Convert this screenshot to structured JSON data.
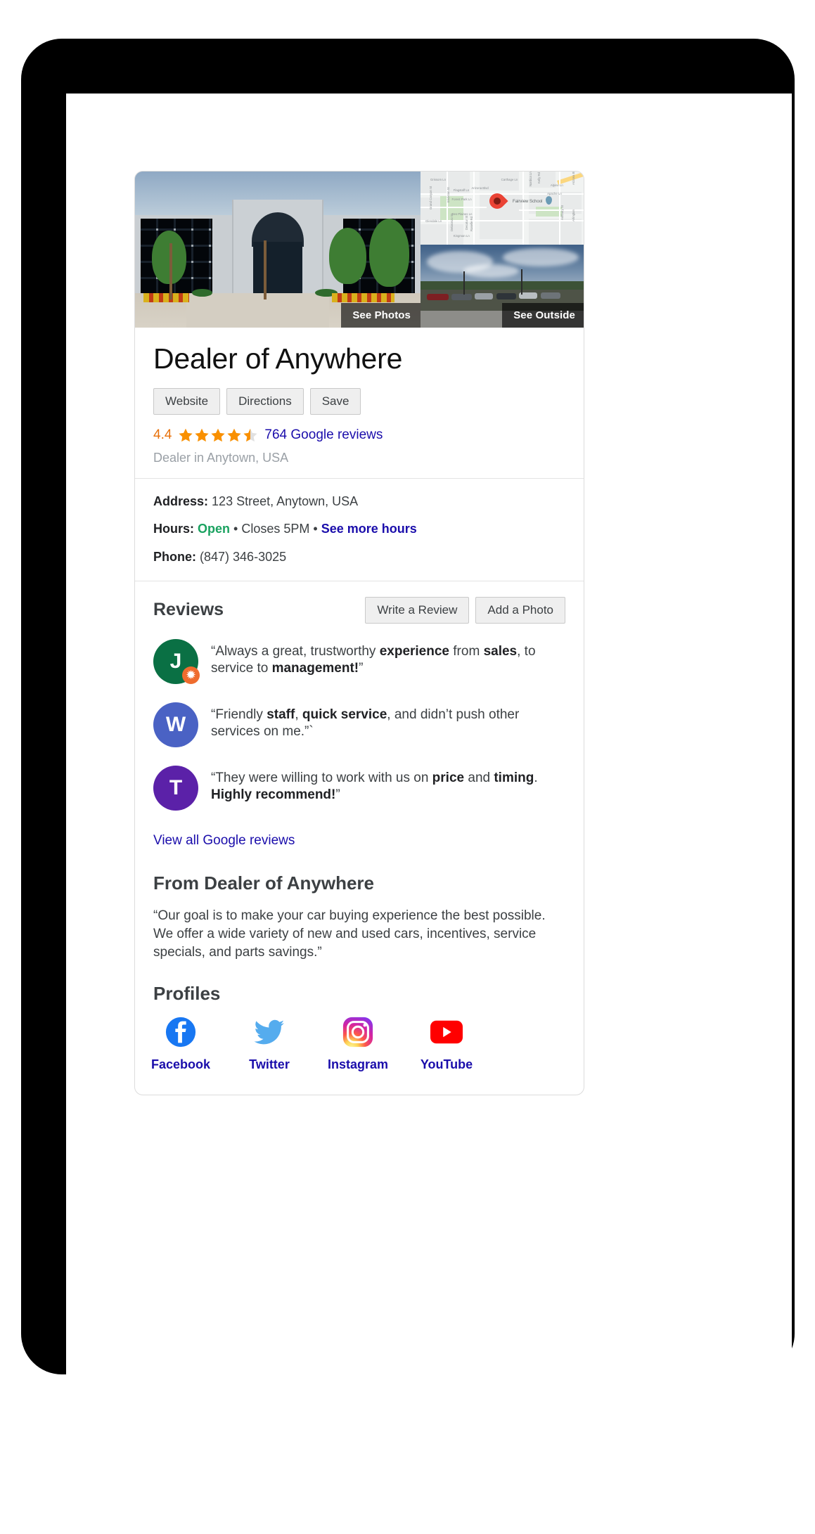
{
  "media": {
    "photos_caption": "See Photos",
    "outside_caption": "See Outside",
    "map": {
      "poi_label": "Fairview School",
      "street_labels": [
        "Grissom Ln",
        "Flagstaff Ln",
        "Forest Park Ln",
        "Des Plaines Ln",
        "Glendale Ln",
        "Kingman Ln",
        "Carthage Ln",
        "Arizona Blvd",
        "Alpine Ln",
        "Apache Ln",
        "Grand Canyon St",
        "Roselle Rd",
        "Decatur St",
        "Deloronzo St",
        "Erickson St",
        "Kelly Rd",
        "Nordica Ln",
        "Arizona Blvd",
        "Ashbury St",
        "Arlington St"
      ]
    }
  },
  "business": {
    "name": "Dealer of Anywhere",
    "category_location": "Dealer in Anytown, USA",
    "actions": [
      {
        "label": "Website"
      },
      {
        "label": "Directions"
      },
      {
        "label": "Save"
      }
    ],
    "rating": {
      "value": "4.4",
      "value_number": 4.4,
      "stars_filled": 4,
      "stars_half": 1,
      "stars_total": 5,
      "reviews_link": "764 Google reviews",
      "review_count": 764
    }
  },
  "facts": {
    "address_label": "Address:",
    "address_value": "123 Street, Anytown, USA",
    "hours_label": "Hours:",
    "hours_status": "Open",
    "hours_sep1": "•",
    "hours_closes": "Closes 5PM",
    "hours_sep2": "•",
    "hours_link": "See more hours",
    "phone_label": "Phone:",
    "phone_value": "(847) 346-3025"
  },
  "reviews": {
    "heading": "Reviews",
    "write_button": "Write a Review",
    "photo_button": "Add a Photo",
    "view_all_link": "View all Google reviews",
    "items": [
      {
        "initial": "J",
        "avatar_color": "#0a7044",
        "badge": true,
        "badge_icon": "star-badge-icon",
        "parts": [
          {
            "t": "“Always a great, trustworthy ",
            "b": false
          },
          {
            "t": "experience",
            "b": true
          },
          {
            "t": " from ",
            "b": false
          },
          {
            "t": "sales",
            "b": true
          },
          {
            "t": ", to service to ",
            "b": false
          },
          {
            "t": "management!",
            "b": true
          },
          {
            "t": "”",
            "b": false
          }
        ]
      },
      {
        "initial": "W",
        "avatar_color": "#4a62c4",
        "badge": false,
        "parts": [
          {
            "t": "“Friendly ",
            "b": false
          },
          {
            "t": "staff",
            "b": true
          },
          {
            "t": ", ",
            "b": false
          },
          {
            "t": "quick service",
            "b": true
          },
          {
            "t": ", and didn’t push other services on me.”`",
            "b": false
          }
        ]
      },
      {
        "initial": "T",
        "avatar_color": "#5b21a8",
        "badge": false,
        "parts": [
          {
            "t": "“They were willing to work with us on ",
            "b": false
          },
          {
            "t": "price",
            "b": true
          },
          {
            "t": " and ",
            "b": false
          },
          {
            "t": "timing",
            "b": true
          },
          {
            "t": ". ",
            "b": false
          },
          {
            "t": "Highly recommend!",
            "b": true
          },
          {
            "t": "”",
            "b": false
          }
        ]
      }
    ]
  },
  "from_dealer": {
    "heading": "From Dealer of Anywhere",
    "body": "“Our goal is to make your car buying experience the best possible. We offer a wide variety of new and used cars, incentives, service specials, and parts savings.”"
  },
  "profiles": {
    "heading": "Profiles",
    "items": [
      {
        "label": "Facebook",
        "icon": "facebook-icon",
        "color": "#1877f2"
      },
      {
        "label": "Twitter",
        "icon": "twitter-icon",
        "color": "#55acee"
      },
      {
        "label": "Instagram",
        "icon": "instagram-icon",
        "color": "#c13584"
      },
      {
        "label": "YouTube",
        "icon": "youtube-icon",
        "color": "#ff0000"
      }
    ]
  },
  "colors": {
    "link": "#1a0dab",
    "star": "#f99000",
    "star_empty": "#e0e0e0",
    "open_green": "#1aa260",
    "rating_orange": "#e8710a",
    "text": "#3c4043",
    "muted": "#9aa0a6"
  }
}
